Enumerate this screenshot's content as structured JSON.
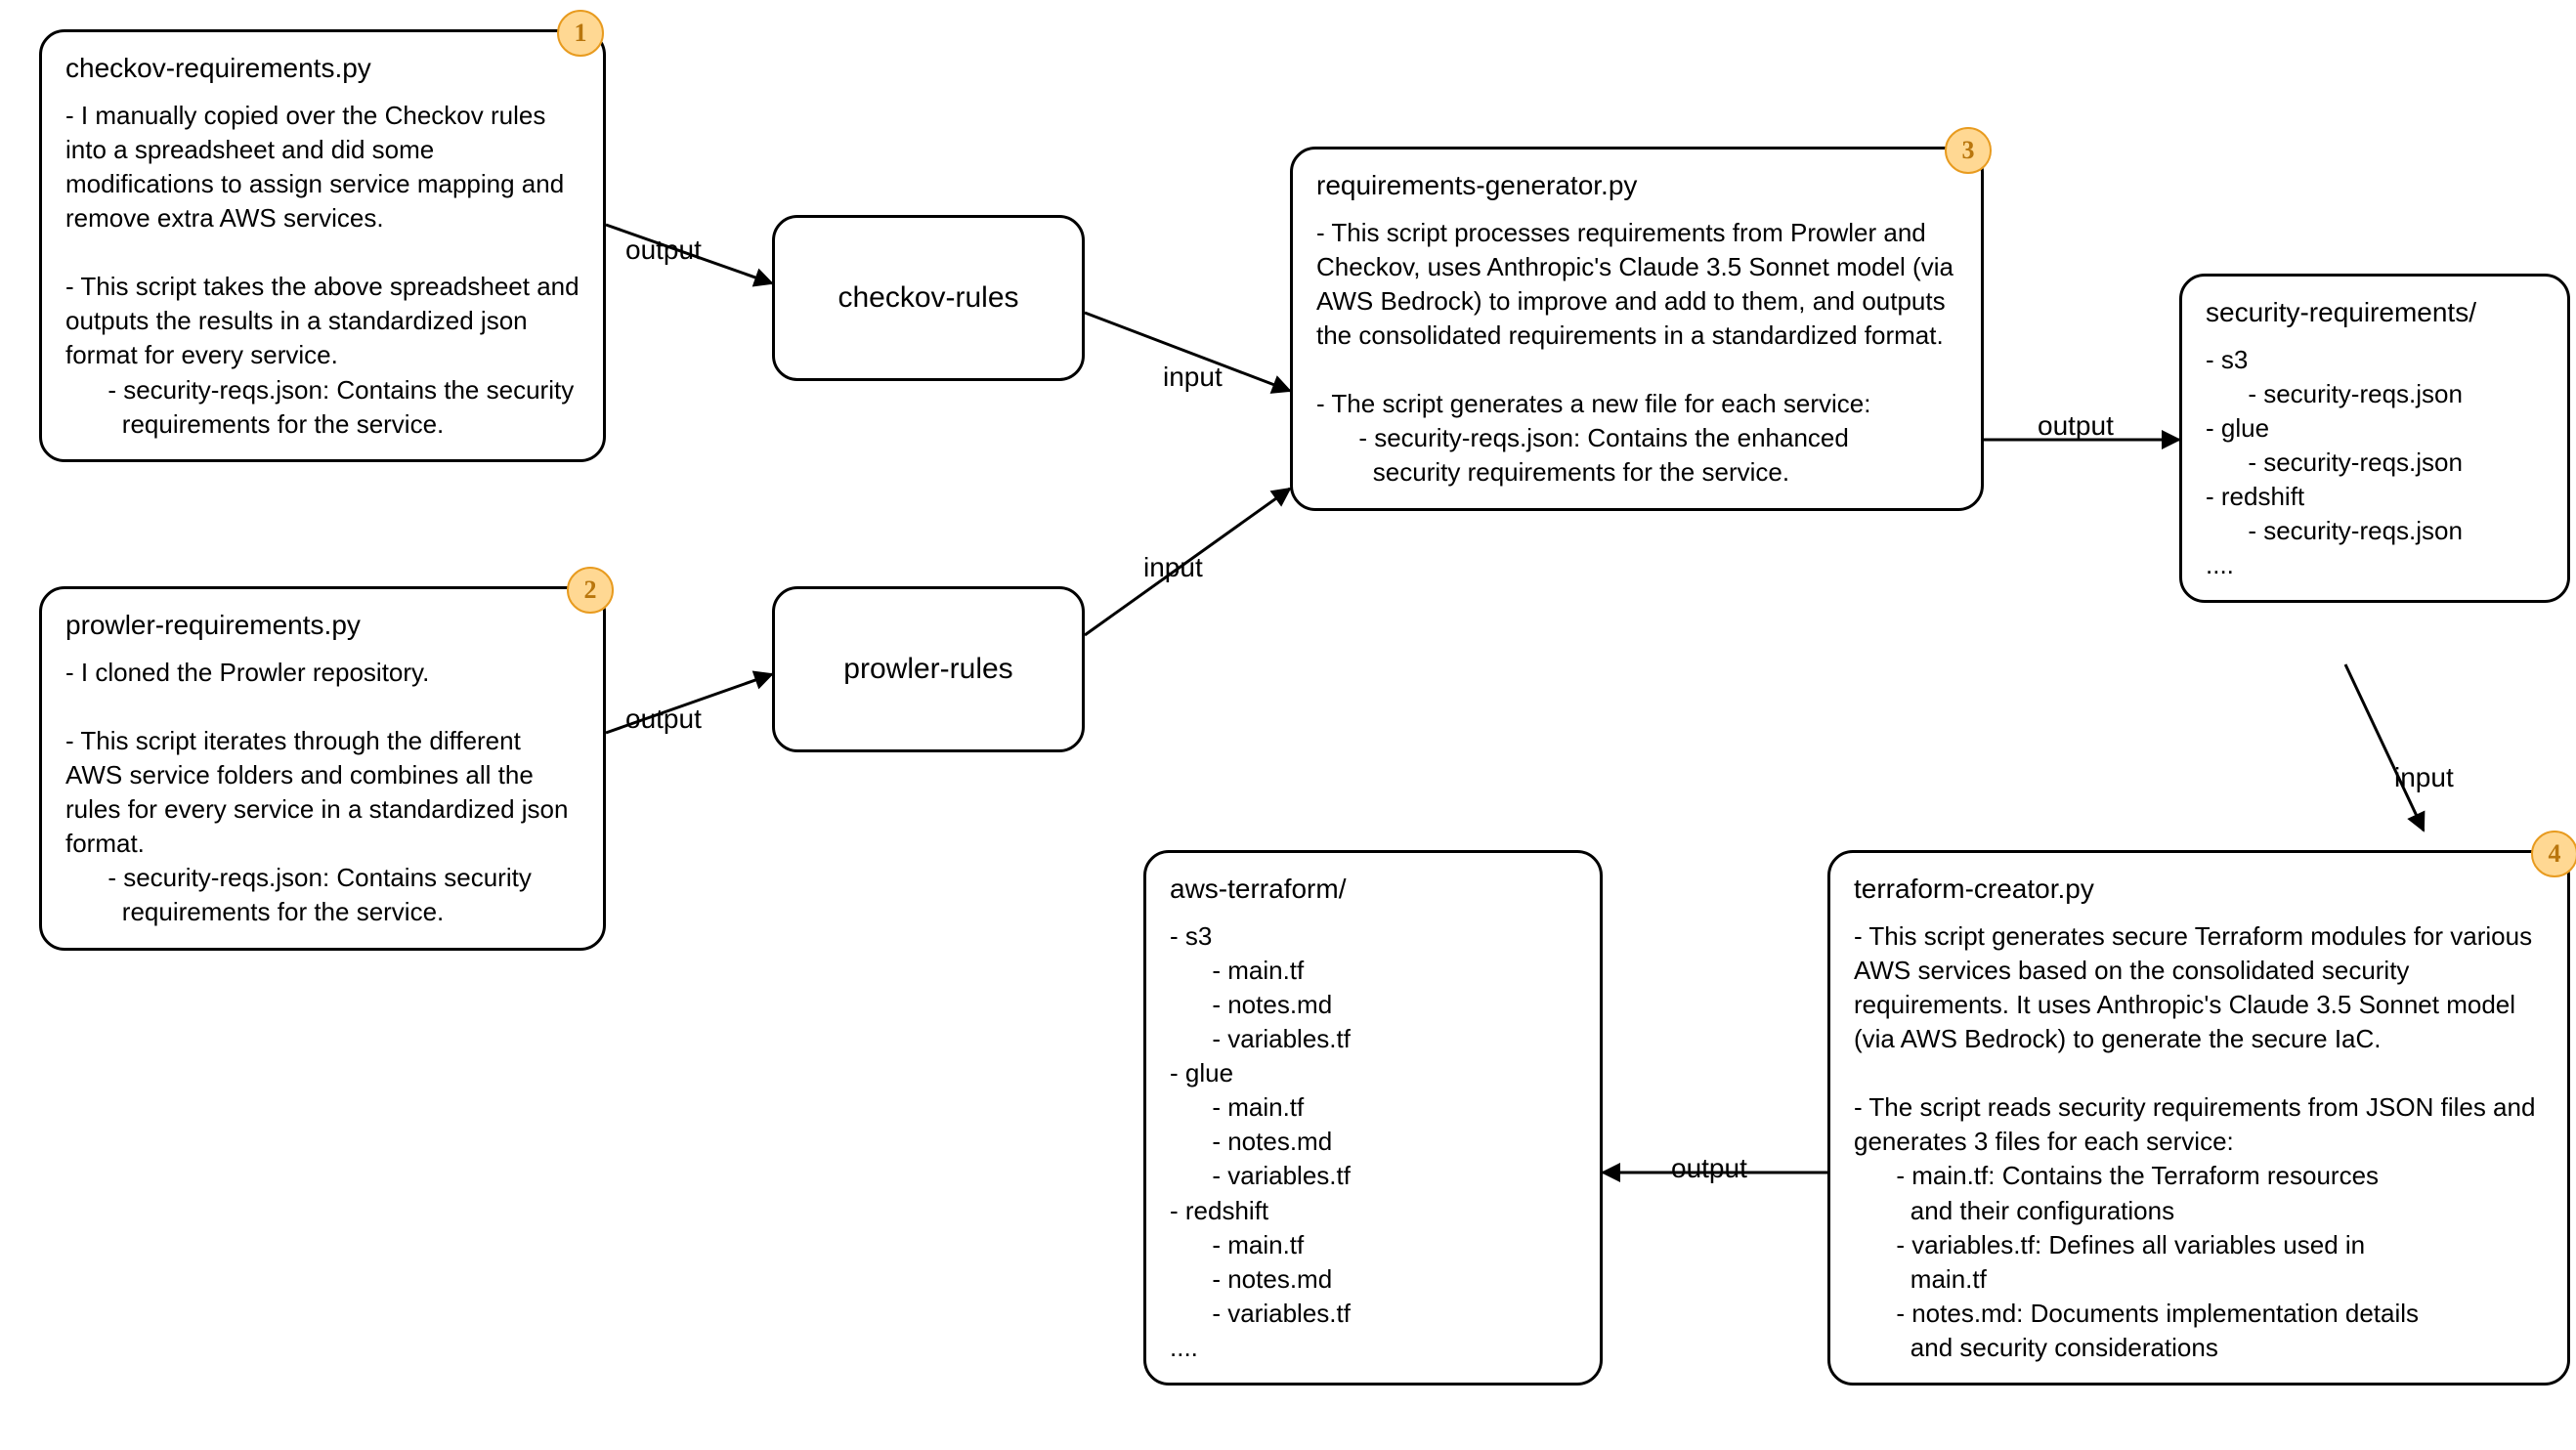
{
  "nodes": {
    "checkov_req": {
      "title": "checkov-requirements.py",
      "body": "- I manually copied over the Checkov rules into a spreadsheet and did some modifications to assign service mapping and remove extra AWS services.\n\n- This script takes the above spreadsheet and outputs the results in a standardized json format for every service.\n      - security-reqs.json: Contains the security\n        requirements for the service.",
      "badge": "1"
    },
    "prowler_req": {
      "title": "prowler-requirements.py",
      "body": "- I cloned the Prowler repository.\n\n- This script iterates through the different AWS service folders and combines all the rules for every service in a standardized json format.\n      - security-reqs.json: Contains security\n        requirements for the service.",
      "badge": "2"
    },
    "checkov_rules": {
      "title": "checkov-rules"
    },
    "prowler_rules": {
      "title": "prowler-rules"
    },
    "req_gen": {
      "title": "requirements-generator.py",
      "body": "- This script processes requirements from Prowler and Checkov, uses Anthropic's Claude 3.5 Sonnet model (via AWS Bedrock) to improve and add to them, and outputs the consolidated requirements in a standardized format.\n\n- The script generates a new file for each service:\n      - security-reqs.json: Contains the enhanced\n        security requirements for the service.",
      "badge": "3"
    },
    "sec_reqs": {
      "title": "security-requirements/",
      "body": "- s3\n      - security-reqs.json\n- glue\n      - security-reqs.json\n- redshift\n      - security-reqs.json\n...."
    },
    "tf_creator": {
      "title": "terraform-creator.py",
      "body": "- This script generates secure Terraform modules for various AWS services based on the consolidated security requirements. It uses Anthropic's Claude 3.5 Sonnet model (via AWS Bedrock) to generate the secure IaC.\n\n- The script reads security requirements from JSON files and generates 3 files for each service:\n      - main.tf: Contains the Terraform resources\n        and their configurations\n      - variables.tf: Defines all variables used in\n        main.tf\n      - notes.md: Documents implementation details\n        and security considerations",
      "badge": "4"
    },
    "aws_tf": {
      "title": "aws-terraform/",
      "body": "- s3\n      - main.tf\n      - notes.md\n      - variables.tf\n- glue\n      - main.tf\n      - notes.md\n      - variables.tf\n- redshift\n      - main.tf\n      - notes.md\n      - variables.tf\n...."
    }
  },
  "edges": {
    "e1": "output",
    "e2": "output",
    "e3": "input",
    "e4": "input",
    "e5": "output",
    "e6": "input",
    "e7": "output"
  }
}
